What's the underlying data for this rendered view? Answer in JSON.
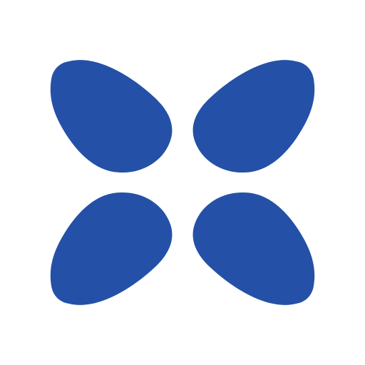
{
  "logo": {
    "icon": "four-petal-x-logo-icon",
    "color": "#2451A7",
    "background": "#FFFFFF"
  }
}
